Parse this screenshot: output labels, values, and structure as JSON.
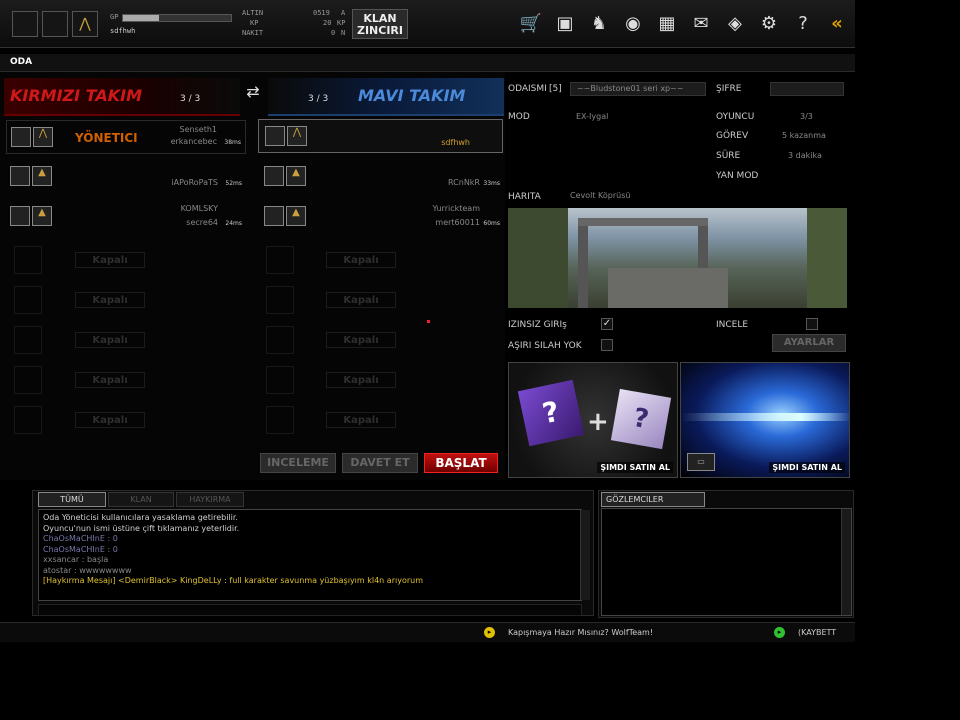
{
  "topbar": {
    "gp_label": "GP",
    "gp_fill_percent": 33,
    "username": "sdfhwh",
    "altin_label": "ALTIN",
    "kp_label": "KP",
    "nakit_label": "NAKIT",
    "altin_value": "0519",
    "kp_value": "20",
    "nakit_value": "0",
    "altin_suffix": "A",
    "kp_suffix": "KP",
    "nakit_suffix": "N",
    "clan_line1": "KLAN",
    "clan_line2": "ZINCIRI",
    "icons": [
      "cart-icon",
      "save-icon",
      "wolf-icon",
      "fire-icon",
      "gift-icon",
      "mail-icon",
      "card-icon",
      "gear-icon",
      "help-icon",
      "collapse-icon"
    ]
  },
  "room": {
    "bar_title": "ODA",
    "red_team": "KIRMIZI TAKIM",
    "red_count": "3 / 3",
    "blue_team": "MAVI TAKIM",
    "blue_count": "3 / 3",
    "red_players": [
      {
        "line1": "Senseth1",
        "line2": "erkancebec",
        "ping": "38ms",
        "badge": "YÖNETICI"
      },
      {
        "line1": "",
        "line2": "iAPoRoPaTS",
        "ping": "52ms"
      },
      {
        "line1": "KOMLSKY",
        "line2": "secre64",
        "ping": "24ms"
      }
    ],
    "blue_players": [
      {
        "line1": "",
        "line2": "sdfhwh",
        "ping": ""
      },
      {
        "line1": "",
        "line2": "RCnNkR",
        "ping": "33ms"
      },
      {
        "line1": "Yurrickteam",
        "line2": "mert60011",
        "ping": "60ms"
      }
    ],
    "closed_label": "Kapalı",
    "btn_inceleme": "INCELEME",
    "btn_davet": "DAVET ET",
    "btn_baslat": "BAŞLAT"
  },
  "info": {
    "odaismi_label": "ODAISMI",
    "odaismi_num": "[5]",
    "odaismi_value": "~~Bludstone01 seri xp~~",
    "sifre_label": "ŞIFRE",
    "mod_label": "MOD",
    "mod_value": "EX-Iygal",
    "oyuncu_label": "OYUNCU",
    "oyuncu_value": "3/3",
    "gorev_label": "GÖREV",
    "gorev_value": "5 kazanma",
    "sure_label": "SÜRE",
    "sure_value": "3 dakika",
    "yanmod_label": "YAN MOD",
    "harita_label": "HARITA",
    "harita_value": "Cevolt Köprüsü",
    "izinsiz_label": "IZINSIZ GIRIş",
    "incele_label": "INCELE",
    "asirsilah_label": "AŞIRI SILAH YOK",
    "ayarlar_label": "AYARLAR",
    "promo1_buy": "ŞIMDI SATIN AL",
    "promo2_buy": "ŞIMDI SATIN AL"
  },
  "chat": {
    "tabs": [
      "TÜMÜ",
      "KLAN",
      "HAYKIRMA"
    ],
    "lines": [
      {
        "text": "Oda Yöneticisi kullanıcılara yasaklama getirebilir.",
        "color": "#d0d0d0"
      },
      {
        "text": "Oyuncu'nun ismi üstüne çift tıklamanız yeterlidir.",
        "color": "#d0d0d0"
      },
      {
        "text": "ChaOsMaCHInE : 0",
        "color": "#7777aa"
      },
      {
        "text": "ChaOsMaCHInE : 0",
        "color": "#7777aa"
      },
      {
        "text": "xxsancar : başla",
        "color": "#888888"
      },
      {
        "text": "atostar : wwwwwwww",
        "color": "#888888"
      },
      {
        "text": "[Haykırma Mesajı] <DemirBlack> KingDeLLy : full karakter savunma yüzbaşıyım kl4n arıyorum",
        "color": "#e0c030"
      }
    ],
    "observers_title": "GÖZLEMCILER"
  },
  "ticker": {
    "text1": "Kapışmaya Hazır Mısınız? WolfTeam!",
    "text2": "(KAYBETT"
  }
}
